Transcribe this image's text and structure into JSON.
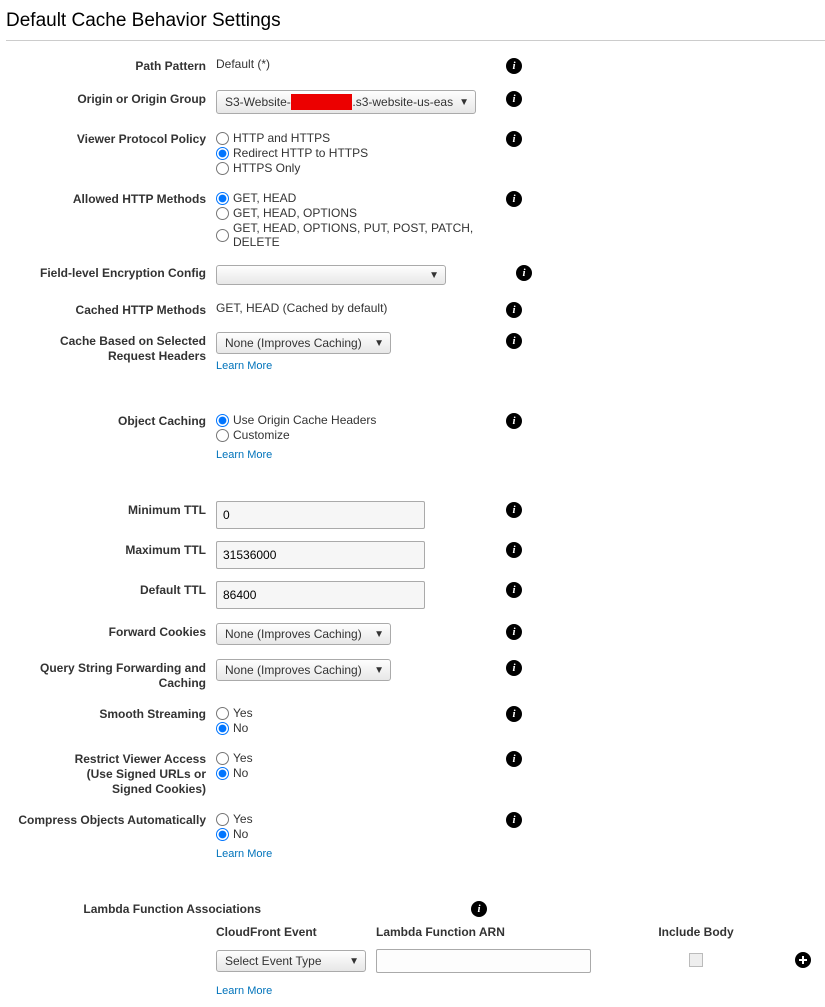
{
  "title": "Default Cache Behavior Settings",
  "labels": {
    "path_pattern": "Path Pattern",
    "origin_group": "Origin or Origin Group",
    "viewer_protocol": "Viewer Protocol Policy",
    "allowed_http": "Allowed HTTP Methods",
    "fle_config": "Field-level Encryption Config",
    "cached_http": "Cached HTTP Methods",
    "cache_based_headers_l1": "Cache Based on Selected",
    "cache_based_headers_l2": "Request Headers",
    "object_caching": "Object Caching",
    "min_ttl": "Minimum TTL",
    "max_ttl": "Maximum TTL",
    "default_ttl": "Default TTL",
    "forward_cookies": "Forward Cookies",
    "qs_forward_l1": "Query String Forwarding and",
    "qs_forward_l2": "Caching",
    "smooth_streaming": "Smooth Streaming",
    "restrict_access_l1": "Restrict Viewer Access",
    "restrict_access_l2": "(Use Signed URLs or",
    "restrict_access_l3": "Signed Cookies)",
    "compress": "Compress Objects Automatically",
    "lambda_assoc": "Lambda Function Associations"
  },
  "values": {
    "path_pattern": "Default (*)",
    "origin_prefix": "S3-Website-",
    "origin_suffix": ".s3-website-us-eas",
    "cached_http": "GET, HEAD (Cached by default)",
    "cache_headers_dropdown": "None (Improves Caching)",
    "forward_cookies_dropdown": "None (Improves Caching)",
    "qs_dropdown": "None (Improves Caching)",
    "fle_dropdown": "",
    "min_ttl": "0",
    "max_ttl": "31536000",
    "default_ttl": "86400",
    "event_type_dropdown": "Select Event Type"
  },
  "radios": {
    "viewer_protocol": {
      "opt1": "HTTP and HTTPS",
      "opt2": "Redirect HTTP to HTTPS",
      "opt3": "HTTPS Only"
    },
    "allowed_http": {
      "opt1": "GET, HEAD",
      "opt2": "GET, HEAD, OPTIONS",
      "opt3": "GET, HEAD, OPTIONS, PUT, POST, PATCH, DELETE"
    },
    "object_caching": {
      "opt1": "Use Origin Cache Headers",
      "opt2": "Customize"
    },
    "yes": "Yes",
    "no": "No"
  },
  "links": {
    "learn_more": "Learn More"
  },
  "lambda": {
    "head_event": "CloudFront Event",
    "head_arn": "Lambda Function ARN",
    "head_include_body": "Include Body"
  }
}
